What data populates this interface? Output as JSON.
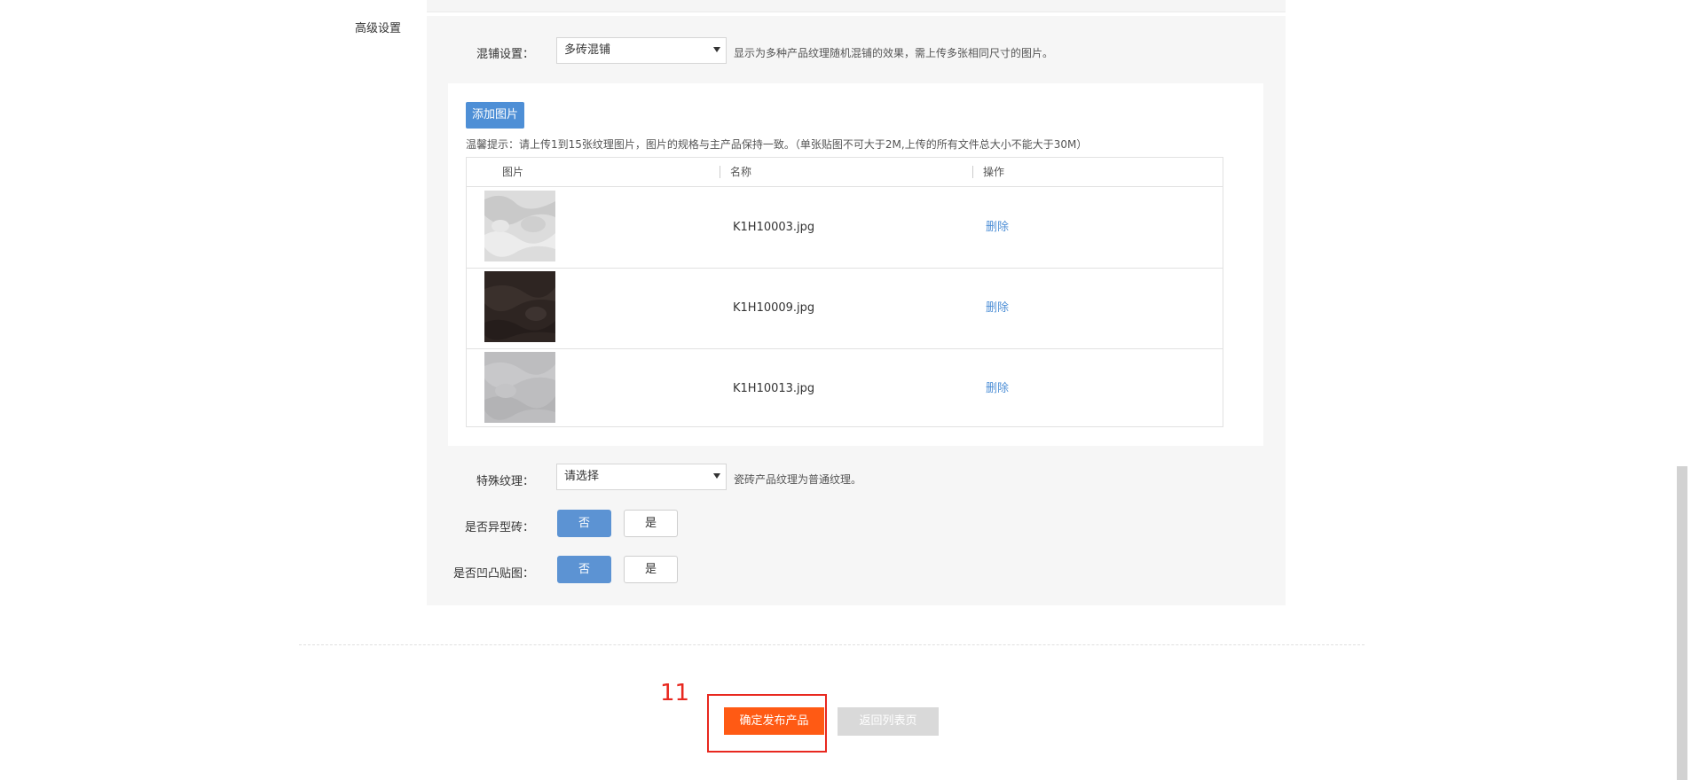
{
  "section": {
    "label": "高级设置"
  },
  "mix_setting": {
    "label": "混铺设置：",
    "selected": "多砖混铺",
    "hint": "显示为多种产品纹理随机混铺的效果，需上传多张相同尺寸的图片。"
  },
  "upload": {
    "add_button": "添加图片",
    "tip": "温馨提示：请上传1到15张纹理图片，图片的规格与主产品保持一致。（单张贴图不可大于2M,上传的所有文件总大小不能大于30M）",
    "columns": [
      "图片",
      "名称",
      "操作"
    ],
    "rows": [
      {
        "name": "K1H10003.jpg",
        "action": "删除",
        "thumb_color": "#d8d8d8"
      },
      {
        "name": "K1H10009.jpg",
        "action": "删除",
        "thumb_color": "#2e2522"
      },
      {
        "name": "K1H10013.jpg",
        "action": "删除",
        "thumb_color": "#bdbdbf"
      }
    ]
  },
  "special_texture": {
    "label": "特殊纹理：",
    "selected": "请选择",
    "hint": "瓷砖产品纹理为普通纹理。"
  },
  "irregular_tile": {
    "label": "是否异型砖：",
    "no": "否",
    "yes": "是",
    "selected": "否"
  },
  "bump_map": {
    "label": "是否凹凸贴图：",
    "no": "否",
    "yes": "是",
    "selected": "否"
  },
  "footer": {
    "step_number": "11",
    "publish_button": "确定发布产品",
    "back_button": "返回列表页"
  },
  "colors": {
    "accent_blue": "#4e8fd6",
    "publish_orange": "#ff5a14",
    "highlight_red": "#e8281f"
  }
}
